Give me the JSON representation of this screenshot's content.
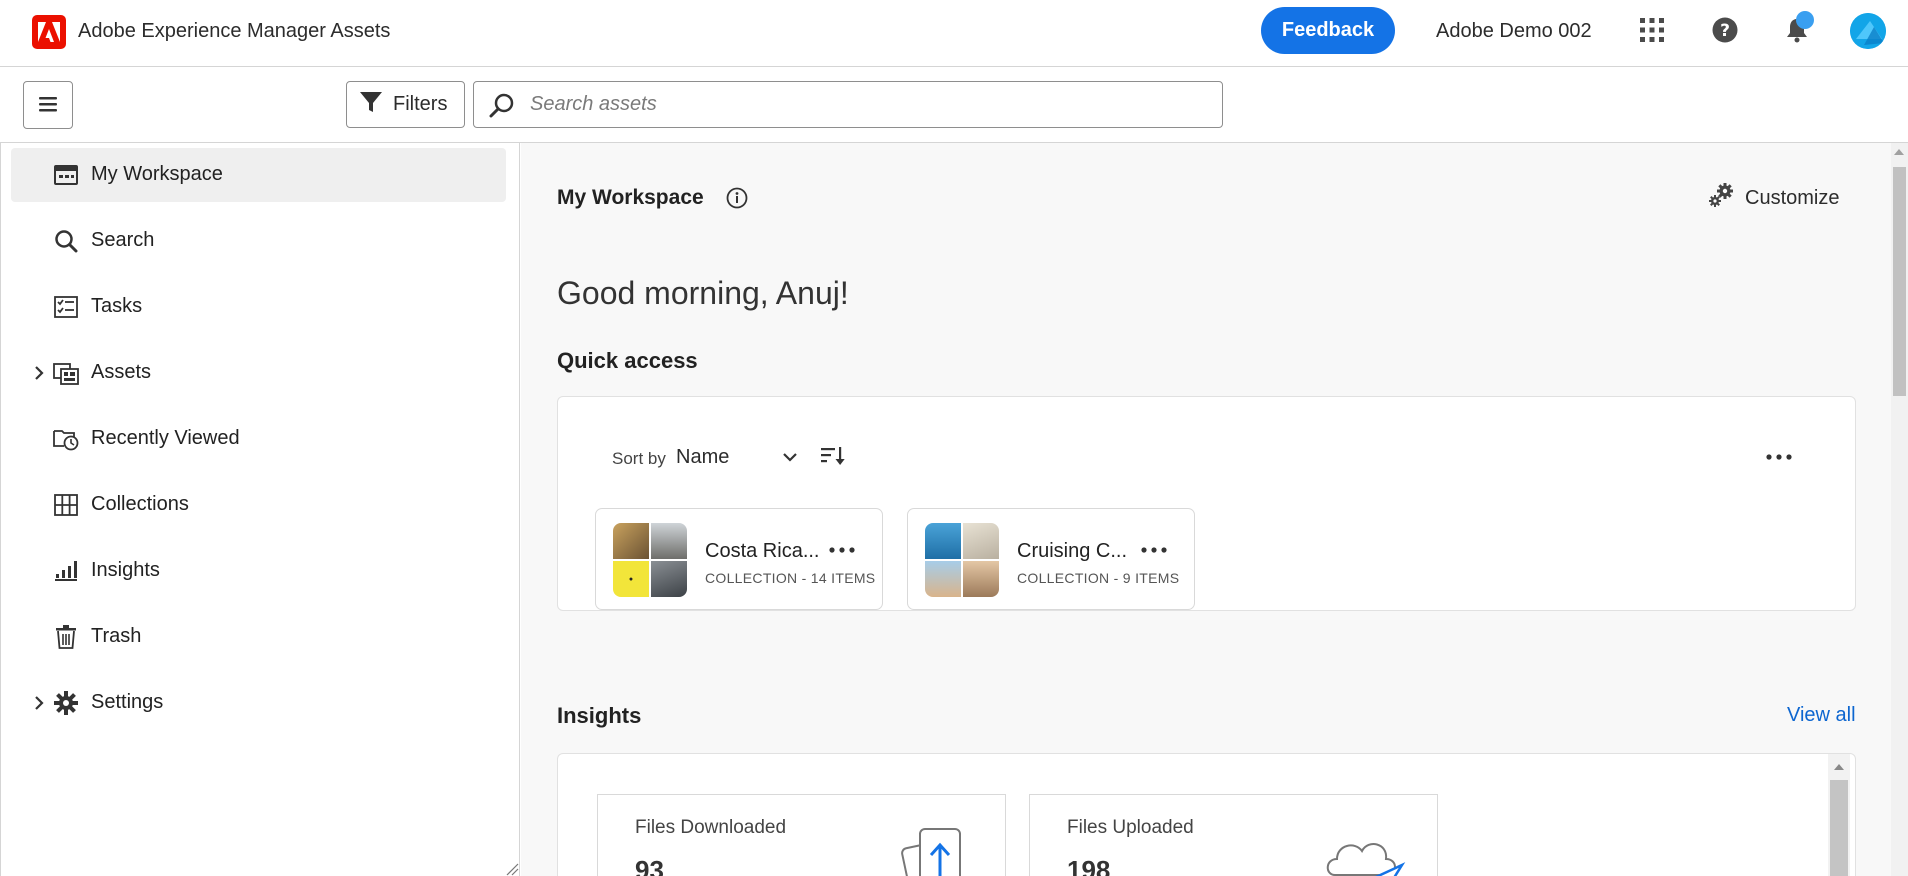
{
  "header": {
    "app_title": "Adobe Experience Manager Assets",
    "feedback_label": "Feedback",
    "org_name": "Adobe Demo 002",
    "icons": [
      "adobe-logo-icon",
      "apps-grid-icon",
      "help-icon",
      "notifications-icon",
      "user-avatar"
    ],
    "accent_color": "#1473e6",
    "brand_color": "#eb1000"
  },
  "toolbar": {
    "filters_label": "Filters",
    "search_placeholder": "Search assets",
    "search_value": ""
  },
  "sidebar": {
    "items": [
      {
        "label": "My Workspace",
        "icon": "workspace-icon",
        "active": true,
        "expandable": false
      },
      {
        "label": "Search",
        "icon": "search-icon",
        "active": false,
        "expandable": false
      },
      {
        "label": "Tasks",
        "icon": "tasks-icon",
        "active": false,
        "expandable": false
      },
      {
        "label": "Assets",
        "icon": "assets-icon",
        "active": false,
        "expandable": true
      },
      {
        "label": "Recently Viewed",
        "icon": "recently-viewed-icon",
        "active": false,
        "expandable": false
      },
      {
        "label": "Collections",
        "icon": "collections-icon",
        "active": false,
        "expandable": false
      },
      {
        "label": "Insights",
        "icon": "insights-icon",
        "active": false,
        "expandable": false
      },
      {
        "label": "Trash",
        "icon": "trash-icon",
        "active": false,
        "expandable": false
      },
      {
        "label": "Settings",
        "icon": "settings-icon",
        "active": false,
        "expandable": true
      }
    ]
  },
  "main": {
    "title": "My Workspace",
    "customize_label": "Customize",
    "greeting": "Good morning, Anuj!",
    "quick_access": {
      "title": "Quick access",
      "sort_by_label": "Sort by",
      "sort_value": "Name",
      "items": [
        {
          "name": "Costa Rica...",
          "meta": "COLLECTION - 14 ITEMS"
        },
        {
          "name": "Cruising C...",
          "meta": "COLLECTION - 9 ITEMS"
        }
      ]
    },
    "insights": {
      "title": "Insights",
      "view_all_label": "View all",
      "cards": [
        {
          "title": "Files Downloaded",
          "value": "93"
        },
        {
          "title": "Files Uploaded",
          "value": "198"
        }
      ]
    }
  }
}
